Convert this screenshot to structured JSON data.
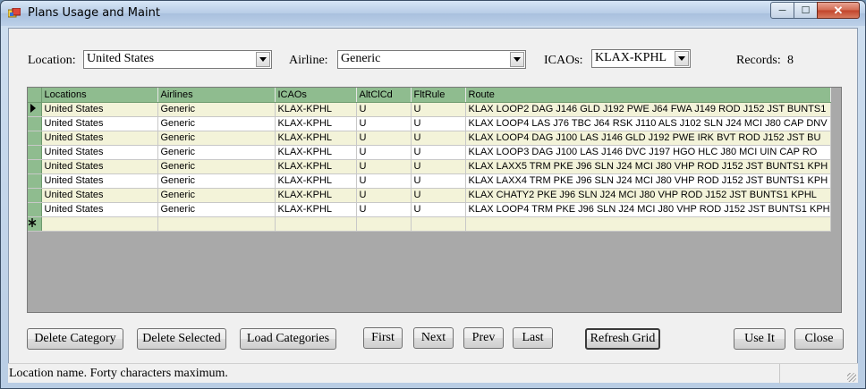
{
  "window": {
    "title": "Plans Usage and Maint",
    "controls": {
      "minimize": "─",
      "maximize": "☐",
      "close": "✕"
    }
  },
  "filters": {
    "location_label": "Location:",
    "location_value": "United States",
    "airline_label": "Airline:",
    "airline_value": "Generic",
    "icaos_label": "ICAOs:",
    "icaos_value": "KLAX-KPHL",
    "records_label": "Records:",
    "records_value": "8"
  },
  "grid": {
    "columns": [
      "Locations",
      "Airlines",
      "ICAOs",
      "AltClCd",
      "FltRule",
      "Route"
    ],
    "rows": [
      [
        "United States",
        "Generic",
        "KLAX-KPHL",
        "U",
        "U",
        "KLAX LOOP2 DAG J146 GLD J192 PWE J64 FWA J149 ROD J152 JST BUNTS1"
      ],
      [
        "United States",
        "Generic",
        "KLAX-KPHL",
        "U",
        "U",
        "KLAX LOOP4  LAS J76 TBC J64 RSK J110 ALS J102 SLN J24 MCI J80 CAP  DNV"
      ],
      [
        "United States",
        "Generic",
        "KLAX-KPHL",
        "U",
        "U",
        "KLAX LOOP4 DAG J100 LAS J146 GLD J192 PWE  IRK  BVT  ROD J152 JST BU"
      ],
      [
        "United States",
        "Generic",
        "KLAX-KPHL",
        "U",
        "U",
        "KLAX LOOP3 DAG J100 LAS J146 DVC J197 HGO  HLC J80 MCI  UIN  CAP  RO"
      ],
      [
        "United States",
        "Generic",
        "KLAX-KPHL",
        "U",
        "U",
        "KLAX LAXX5 TRM  PKE J96 SLN J24 MCI J80 VHP  ROD J152 JST BUNTS1 KPH"
      ],
      [
        "United States",
        "Generic",
        "KLAX-KPHL",
        "U",
        "U",
        "KLAX LAXX4 TRM  PKE J96 SLN J24 MCI J80 VHP  ROD J152 JST BUNTS1 KPH"
      ],
      [
        "United States",
        "Generic",
        "KLAX-KPHL",
        "U",
        "U",
        "KLAX CHATY2  PKE J96 SLN J24 MCI J80 VHP  ROD J152 JST BUNTS1 KPHL"
      ],
      [
        "United States",
        "Generic",
        "KLAX-KPHL",
        "U",
        "U",
        "KLAX LOOP4 TRM  PKE J96 SLN J24 MCI J80 VHP  ROD J152 JST BUNTS1 KPH"
      ]
    ]
  },
  "buttons": {
    "delete_category": "Delete Category",
    "delete_selected": "Delete Selected",
    "load_categories": "Load Categories",
    "first": "First",
    "next": "Next",
    "prev": "Prev",
    "last": "Last",
    "refresh_grid": "Refresh Grid",
    "use_it": "Use It",
    "close": "Close"
  },
  "status": {
    "message": "Location name. Forty characters maximum."
  },
  "icons": {
    "app": "app-window-icon",
    "current_row": "row-pointer-icon",
    "new_row": "new-row-asterisk-icon",
    "dropdown": "chevron-down-icon"
  }
}
